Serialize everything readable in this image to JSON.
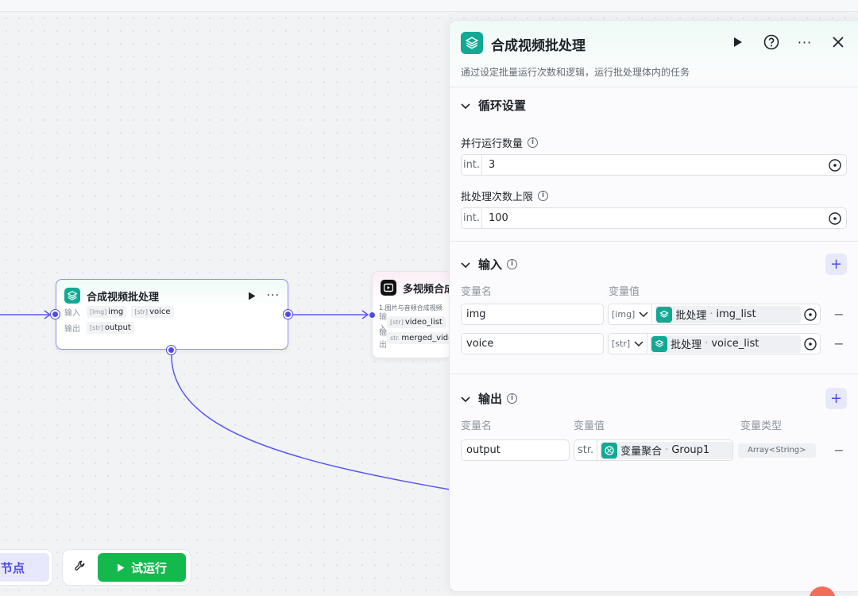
{
  "canvas": {
    "nodes": {
      "batch": {
        "title": "合成视频批处理",
        "input_label": "输入",
        "output_label": "输出",
        "inputs": [
          {
            "type": "[img]",
            "name": "img"
          },
          {
            "type": "[str]",
            "name": "voice"
          }
        ],
        "outputs": [
          {
            "type": "[str]",
            "name": "output"
          }
        ]
      },
      "video": {
        "title": "多视频合成",
        "desc": "1.图片与音频合成视频",
        "input_label": "输入",
        "output_label": "输出",
        "input_type": "[str]",
        "input_name": "video_list",
        "output_type": "str.",
        "output_name": "merged_video"
      }
    },
    "toolbar": {
      "add_node": "加节点",
      "run": "试运行"
    }
  },
  "panel": {
    "title": "合成视频批处理",
    "description": "通过设定批量运行次数和逻辑，运行批处理体内的任务",
    "loop": {
      "title": "循环设置",
      "parallel_label": "并行运行数量",
      "parallel_type": "int.",
      "parallel_value": "3",
      "max_label": "批处理次数上限",
      "max_type": "int.",
      "max_value": "100"
    },
    "input": {
      "title": "输入",
      "col_name": "变量名",
      "col_value": "变量值",
      "rows": [
        {
          "name": "img",
          "type": "[img]",
          "source": "批处理",
          "field": "img_list"
        },
        {
          "name": "voice",
          "type": "[str]",
          "source": "批处理",
          "field": "voice_list"
        }
      ]
    },
    "output": {
      "title": "输出",
      "col_name": "变量名",
      "col_value": "变量值",
      "col_type": "变量类型",
      "rows": [
        {
          "name": "output",
          "type": "str.",
          "source": "变量聚合",
          "field": "Group1",
          "var_type": "Array<String>"
        }
      ]
    }
  },
  "colors": {
    "accent": "#4e4bdf",
    "node_icon": "#12a894",
    "run_green": "#14b94e"
  }
}
